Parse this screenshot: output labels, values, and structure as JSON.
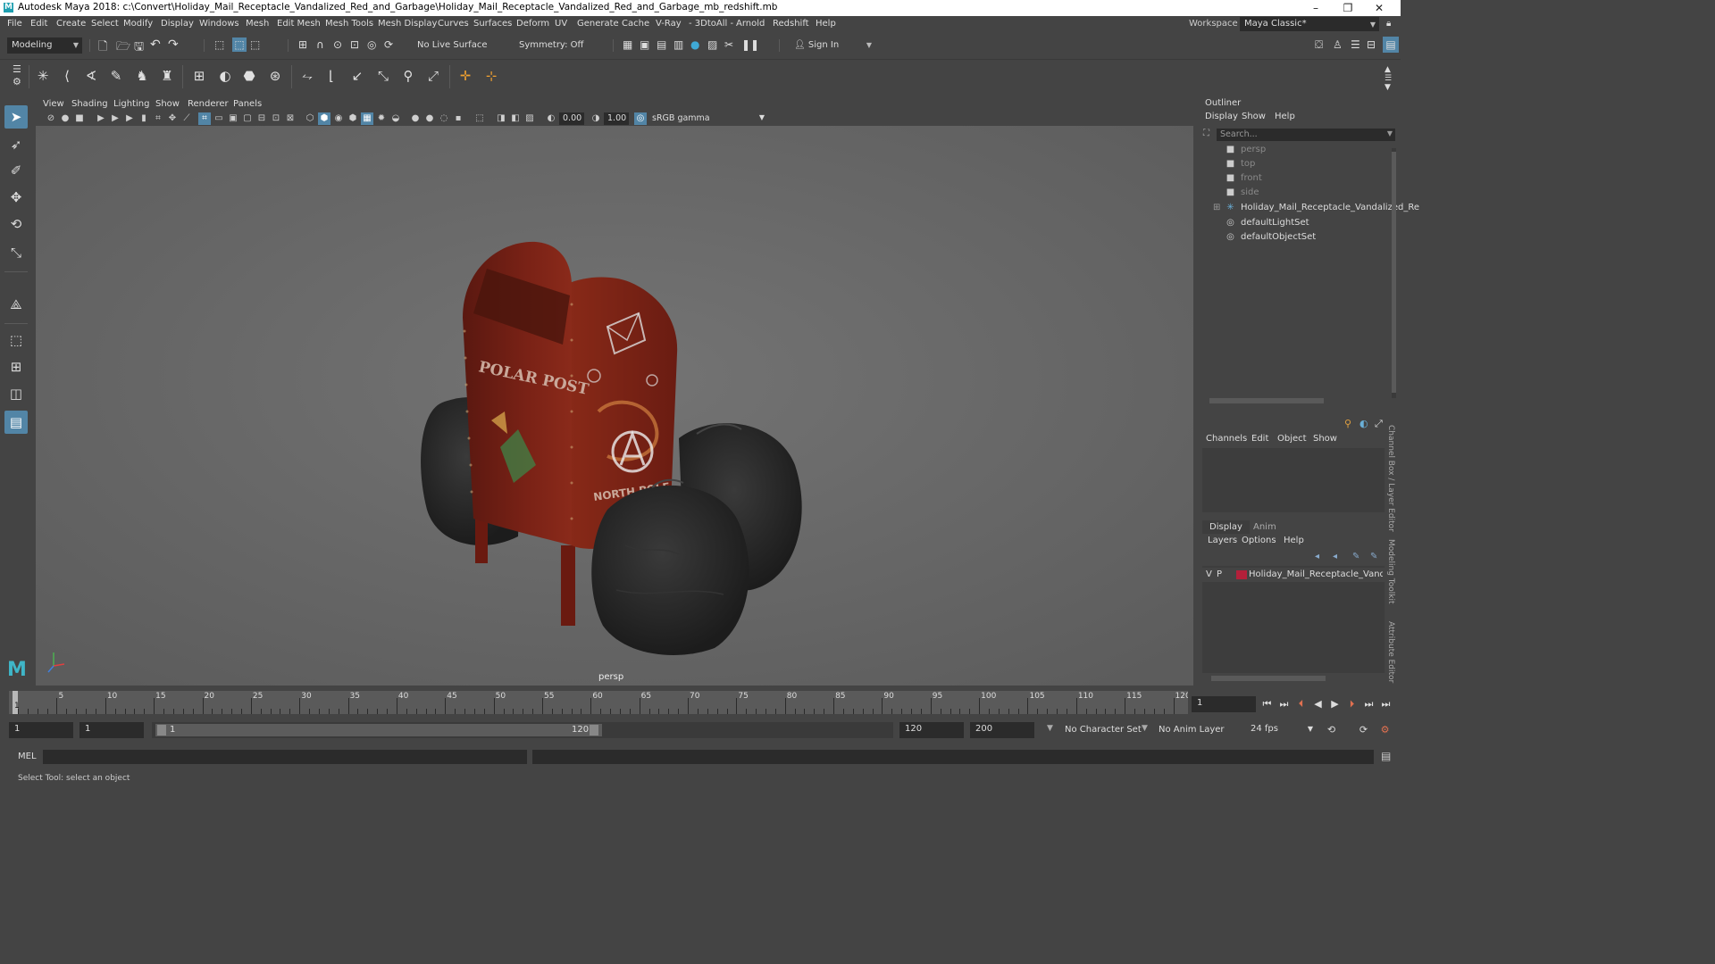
{
  "title_bar": {
    "logo": "M",
    "title": "Autodesk Maya 2018: c:\\Convert\\Holiday_Mail_Receptacle_Vandalized_Red_and_Garbage\\Holiday_Mail_Receptacle_Vandalized_Red_and_Garbage_mb_redshift.mb",
    "minimize": "–",
    "maximize": "❐",
    "close": "✕"
  },
  "menubar": {
    "items": [
      "File",
      "Edit",
      "Create",
      "Select",
      "Modify",
      "Display",
      "Windows",
      "Mesh",
      "Edit Mesh",
      "Mesh Tools",
      "Mesh Display",
      "Curves",
      "Surfaces",
      "Deform",
      "UV",
      "Generate",
      "Cache",
      "V-Ray",
      "- 3DtoAll -",
      "Arnold",
      "Redshift",
      "Help"
    ],
    "workspace_label": "Workspace :",
    "workspace_value": "Maya Classic*"
  },
  "status_line": {
    "menu_set": "Modeling",
    "live_surface": "No Live Surface",
    "symmetry": "Symmetry: Off",
    "sign_in": "Sign In"
  },
  "viewport": {
    "menus": [
      "View",
      "Shading",
      "Lighting",
      "Show",
      "Renderer",
      "Panels"
    ],
    "exposure": "0.00",
    "gamma": "1.00",
    "color_space": "sRGB gamma",
    "camera_label": "persp",
    "mailbox_text": "POLAR POST",
    "mailbox_side_text": "NORTH POLE",
    "colors": {
      "background": "#6d6d6d",
      "mailbox_red": "#7a2216",
      "bag": "#262626"
    }
  },
  "outliner": {
    "title": "Outliner",
    "menus": [
      "Display",
      "Show",
      "Help"
    ],
    "search_placeholder": "Search...",
    "items": [
      {
        "label": "persp",
        "icon": "camera-icon",
        "dim": true
      },
      {
        "label": "top",
        "icon": "camera-icon",
        "dim": true
      },
      {
        "label": "front",
        "icon": "camera-icon",
        "dim": true
      },
      {
        "label": "side",
        "icon": "camera-icon",
        "dim": true
      },
      {
        "label": "Holiday_Mail_Receptacle_Vandalized_Re",
        "icon": "group-icon",
        "dim": false
      },
      {
        "label": "defaultLightSet",
        "icon": "set-icon",
        "dim": false
      },
      {
        "label": "defaultObjectSet",
        "icon": "set-icon",
        "dim": false
      }
    ]
  },
  "channel_box": {
    "menus": [
      "Channels",
      "Edit",
      "Object",
      "Show"
    ]
  },
  "layer_editor": {
    "tabs": [
      "Display",
      "Anim"
    ],
    "menus": [
      "Layers",
      "Options",
      "Help"
    ],
    "layer": {
      "v": "V",
      "p": "P",
      "name": "Holiday_Mail_Receptacle_Vandalized",
      "color": "#b3203a"
    }
  },
  "side_tabs": [
    "Channel Box / Layer Editor",
    "Modeling Toolkit",
    "Attribute Editor"
  ],
  "time_slider": {
    "ticks": [
      "5",
      "10",
      "15",
      "20",
      "25",
      "30",
      "35",
      "40",
      "45",
      "50",
      "55",
      "60",
      "65",
      "70",
      "75",
      "80",
      "85",
      "90",
      "95",
      "100",
      "105",
      "110",
      "115",
      "120"
    ],
    "current_frame_marker": "1",
    "current_frame": "1"
  },
  "range_slider": {
    "start": "1",
    "playback_start": "1",
    "range_start_label": "1",
    "range_end_label": "120",
    "playback_end": "120",
    "end": "200",
    "character_set": "No Character Set",
    "anim_layer": "No Anim Layer",
    "fps": "24 fps"
  },
  "command_line": {
    "label": "MEL"
  },
  "help_line": {
    "text": "Select Tool: select an object"
  }
}
